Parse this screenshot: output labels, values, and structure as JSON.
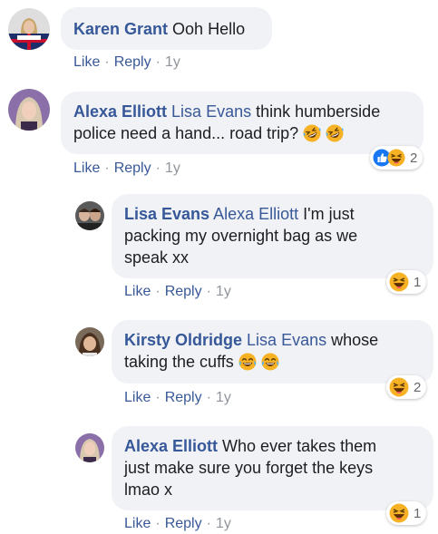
{
  "colors": {
    "author": "#365899",
    "mention": "#385898",
    "bubble": "#f0f2f5",
    "meta": "#90949c",
    "like_blue": "#1877f2",
    "emoji_yellow": "#f7b125"
  },
  "action_labels": {
    "like": "Like",
    "reply": "Reply",
    "separator": "·"
  },
  "comments": [
    {
      "author": "Karen Grant",
      "mention": "",
      "text": "Ooh Hello",
      "time": "1y",
      "avatar_icon": "avatar-karen-grant"
    },
    {
      "author": "Alexa Elliott",
      "mention": "Lisa Evans",
      "text_line1": "think humberside",
      "text_line2": "police need a hand... road trip?",
      "emoji": "rofl-emoji x2",
      "time": "1y",
      "reactions": {
        "icons": [
          "like-reaction-icon",
          "haha-reaction-icon"
        ],
        "count": "2"
      }
    },
    {
      "author": "Lisa Evans",
      "mention": "Alexa Elliott",
      "text_line1": "I'm just",
      "text_line2": "packing my overnight bag as we",
      "text_line3": "speak xx",
      "time": "1y",
      "reactions": {
        "icons": [
          "haha-reaction-icon"
        ],
        "count": "1"
      }
    },
    {
      "author": "Kirsty Oldridge",
      "mention": "Lisa Evans",
      "text_line1": "whose",
      "text_line2": "taking the cuffs",
      "emoji": "joy-emoji x2",
      "time": "1y",
      "reactions": {
        "icons": [
          "haha-reaction-icon"
        ],
        "count": "2"
      }
    },
    {
      "author": "Alexa Elliott",
      "mention": "",
      "text_line1": "Who ever takes them",
      "text_line2": "just make sure you forget the keys",
      "text_line3": "lmao x",
      "time": "1y",
      "reactions": {
        "icons": [
          "haha-reaction-icon"
        ],
        "count": "1"
      }
    }
  ]
}
